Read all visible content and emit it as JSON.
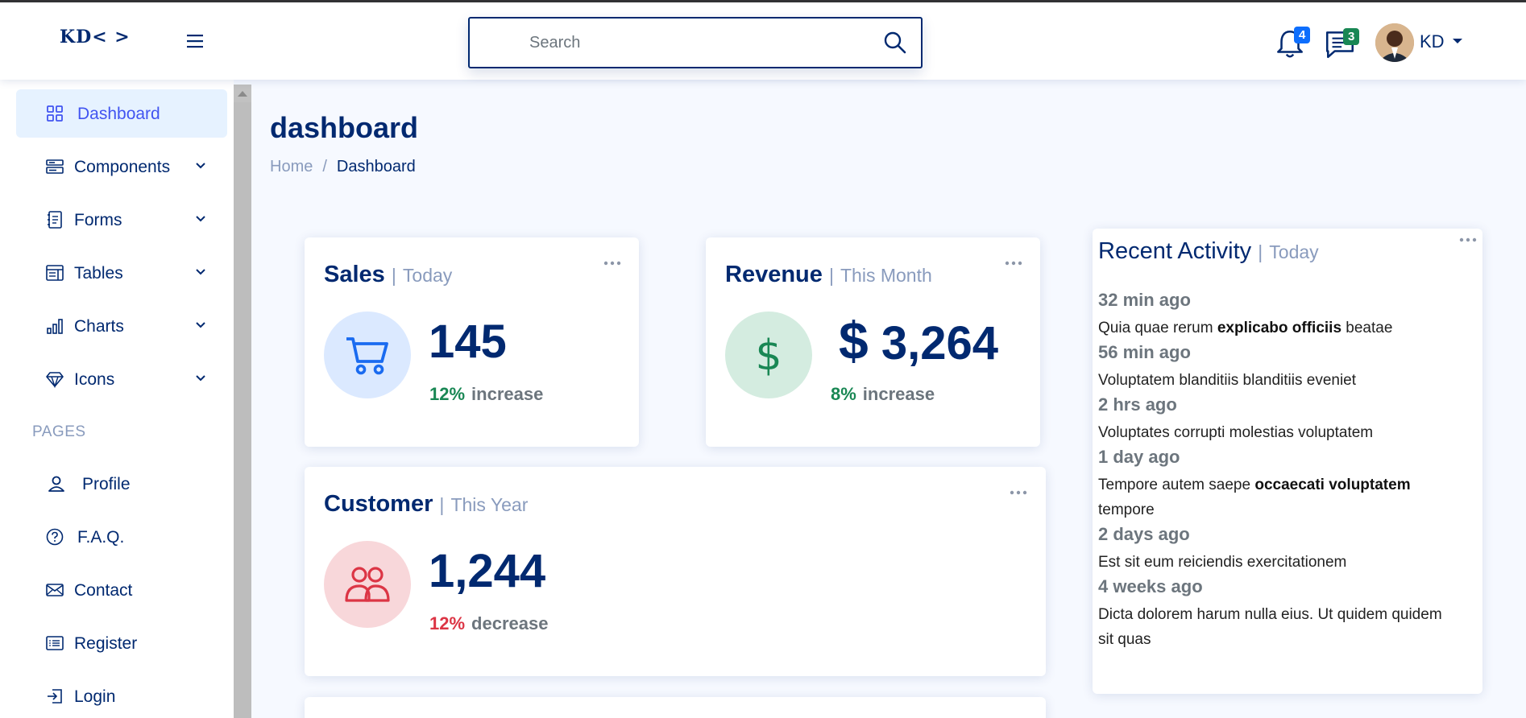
{
  "header": {
    "logo": "KD< >",
    "search_placeholder": "Search",
    "notifications_count": "4",
    "messages_count": "3",
    "user_initials": "KD",
    "colors": {
      "primary": "#012970",
      "accent": "#4154f1",
      "notif_badge": "#0d6efd",
      "msg_badge": "#198754"
    }
  },
  "sidebar": {
    "items": [
      {
        "label": "Dashboard",
        "icon": "grid-icon",
        "active": true
      },
      {
        "label": "Components",
        "icon": "menu-button-icon",
        "expandable": true
      },
      {
        "label": "Forms",
        "icon": "journal-text-icon",
        "expandable": true
      },
      {
        "label": "Tables",
        "icon": "layout-text-window-icon",
        "expandable": true
      },
      {
        "label": "Charts",
        "icon": "bar-chart-icon",
        "expandable": true
      },
      {
        "label": "Icons",
        "icon": "gem-icon",
        "expandable": true
      }
    ],
    "section_heading": "PAGES",
    "pages": [
      {
        "label": "Profile",
        "icon": "person-icon"
      },
      {
        "label": "F.A.Q.",
        "icon": "question-circle-icon"
      },
      {
        "label": "Contact",
        "icon": "envelope-icon"
      },
      {
        "label": "Register",
        "icon": "card-list-icon"
      },
      {
        "label": "Login",
        "icon": "box-arrow-in-right-icon"
      }
    ]
  },
  "page": {
    "title": "dashboard",
    "breadcrumb": {
      "home": "Home",
      "separator": "/",
      "current": "Dashboard"
    }
  },
  "cards": {
    "sales": {
      "title": "Sales",
      "divider": "|",
      "period": "Today",
      "value": "145",
      "pct": "12%",
      "trend": "increase",
      "trend_color": "#198754"
    },
    "revenue": {
      "title": "Revenue",
      "divider": "|",
      "period": "This Month",
      "currency": "$",
      "value": "3,264",
      "pct": "8%",
      "trend": "increase",
      "trend_color": "#198754"
    },
    "customer": {
      "title": "Customer",
      "divider": "|",
      "period": "This Year",
      "value": "1,244",
      "pct": "12%",
      "trend": "decrease",
      "trend_color": "#dc3545"
    }
  },
  "activity": {
    "title": "Recent Activity",
    "divider": "|",
    "period": "Today",
    "items": [
      {
        "time": "32 min ago",
        "text_before": "Quia quae rerum ",
        "bold": "explicabo officiis",
        "text_after": " beatae"
      },
      {
        "time": "56 min ago",
        "text_before": "Voluptatem blanditiis blanditiis eveniet",
        "bold": "",
        "text_after": ""
      },
      {
        "time": "2 hrs ago",
        "text_before": "Voluptates corrupti molestias voluptatem",
        "bold": "",
        "text_after": ""
      },
      {
        "time": "1 day ago",
        "text_before": "Tempore autem saepe ",
        "bold": "occaecati voluptatem",
        "text_after": " tempore"
      },
      {
        "time": "2 days ago",
        "text_before": "Est sit eum reiciendis exercitationem",
        "bold": "",
        "text_after": ""
      },
      {
        "time": "4 weeks ago",
        "text_before": "Dicta dolorem harum nulla eius. Ut quidem quidem sit quas",
        "bold": "",
        "text_after": ""
      }
    ]
  }
}
